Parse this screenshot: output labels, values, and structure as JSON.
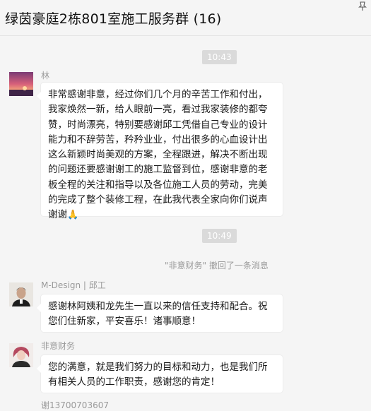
{
  "window": {
    "title": "绿茵豪庭2栋801室施工服务群 (16)"
  },
  "icons": {
    "pin": "pin-icon",
    "praying_hands": "🙏"
  },
  "colors": {
    "bubble": "#ffffff",
    "time_badge": "#dadada",
    "muted_text": "#9a9a9a"
  },
  "timestamps": [
    "10:43",
    "10:49"
  ],
  "messages": [
    {
      "sender": "林",
      "text_lines": [
        "非常感谢非意，经过你们几个月的辛苦工作和付出，",
        "我家焕然一新，给人眼前一亮，看过我家装修的都夸",
        "赞，时尚漂亮，特别要感谢邱工凭借自己专业的设计",
        "能力和不辞劳苦，矜矜业业，付出很多的心血设计出",
        "这么新颖时尚美观的方案，全程跟进，解决不断出现",
        "的问题还要感谢谢工的施工监督到位，感谢非意的老",
        "板全程的关注和指导以及各位施工人员的劳动，完美",
        "的完成了整个装修工程，在此我代表全家向你们说声"
      ],
      "last_line_text": "谢谢"
    },
    {
      "sender": "M-Design | 邱工",
      "text_lines": [
        "感谢林阿姨和龙先生一直以来的信任支持和配合。祝",
        "您们住新家，平安喜乐！诸事顺意！"
      ]
    },
    {
      "sender": "非意财务",
      "text_lines": [
        "您的满意，就是我们努力的目标和动力，也是我们所",
        "有相关人员的工作职责，感谢您的肯定！"
      ]
    }
  ],
  "system_notice": "\"非意财务\" 撤回了一条消息",
  "partial_sender": "谢13700703607"
}
